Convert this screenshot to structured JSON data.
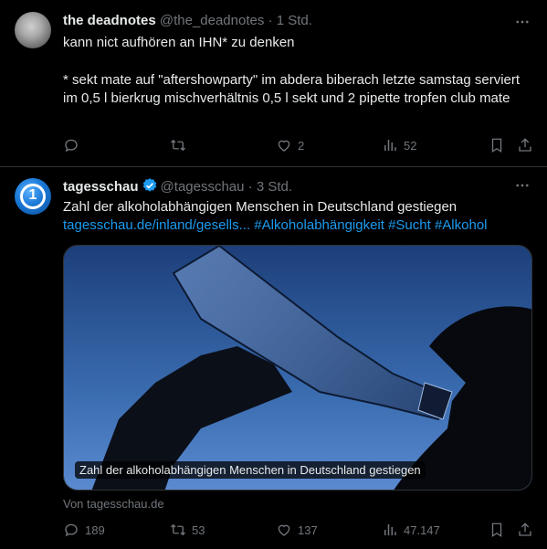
{
  "tweets": [
    {
      "author": "the deadnotes",
      "handle": "@the_deadnotes",
      "time": "· 1 Std.",
      "text_line1": "kann nict aufhören an IHN* zu denken",
      "text_line2": "* sekt mate auf \"aftershowparty\" im abdera biberach letzte samstag serviert im 0,5 l bierkrug mischverhältnis 0,5 l sekt und 2 pipette tropfen club mate",
      "actions": {
        "replies": "",
        "retweets": "",
        "likes": "2",
        "views": "52"
      }
    },
    {
      "author": "tagesschau",
      "handle": "@tagesschau",
      "time": "· 3 Std.",
      "avatar_text": "1",
      "text": "Zahl der alkoholabhängigen Menschen in Deutschland gestiegen",
      "link": "tagesschau.de/inland/gesells...",
      "hashtags": "#Alkoholabhängigkeit #Sucht #Alkohol",
      "card_caption": "Zahl der alkoholabhängigen Menschen in Deutschland gestiegen",
      "card_source": "Von tagesschau.de",
      "actions": {
        "replies": "189",
        "retweets": "53",
        "likes": "137",
        "views": "47.147"
      }
    }
  ],
  "colors": {
    "background": "#000000",
    "text": "#e7e9ea",
    "muted": "#71767b",
    "link": "#1d9bf0",
    "border": "#2f3336",
    "verified": "#1d9bf0"
  },
  "icons": [
    "more-icon",
    "reply-icon",
    "retweet-icon",
    "like-icon",
    "views-icon",
    "bookmark-icon",
    "share-icon",
    "verified-icon"
  ]
}
